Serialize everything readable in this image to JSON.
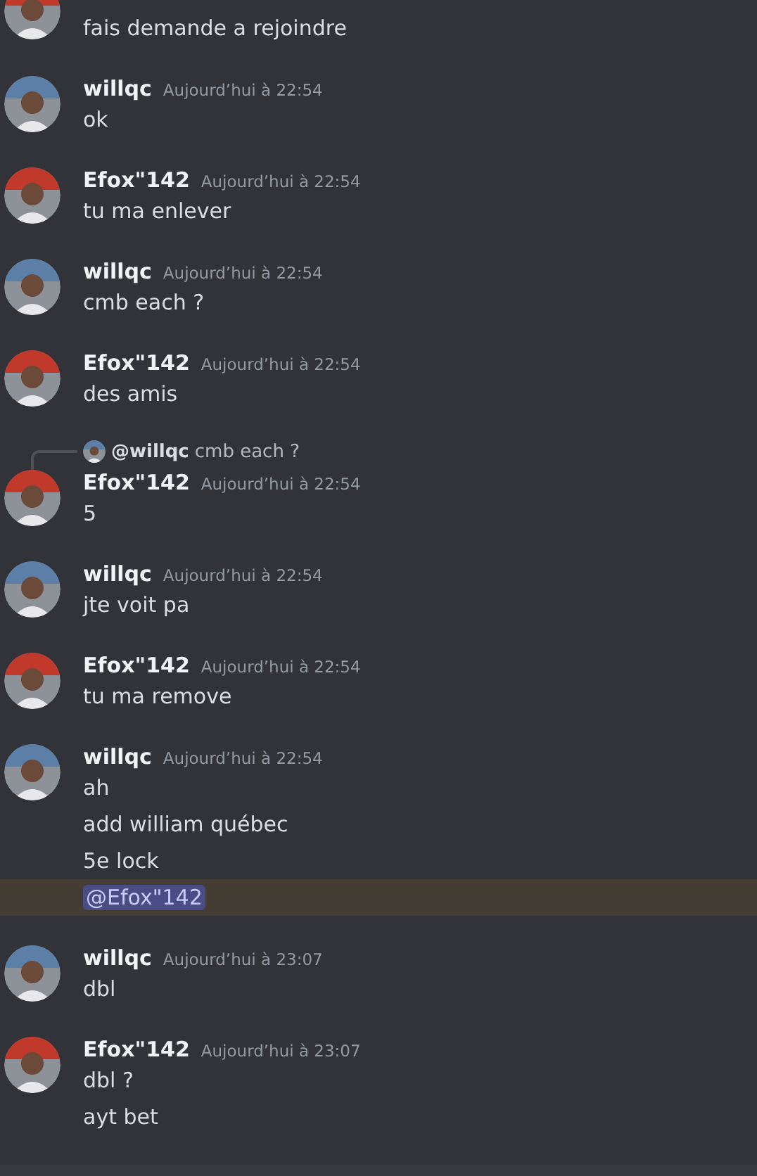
{
  "messages": [
    {
      "kind": "cut",
      "color": "#c0392b",
      "lines": [
        {
          "kind": "text",
          "text": "fais demande a rejoindre",
          "highlighted": false
        }
      ]
    },
    {
      "kind": "full",
      "author": "willqc",
      "time": "Aujourd’hui à 22:54",
      "color": "#5b7fa6",
      "lines": [
        {
          "kind": "text",
          "text": "ok",
          "highlighted": false
        }
      ]
    },
    {
      "kind": "full",
      "author": "Efox\"142",
      "time": "Aujourd’hui à 22:54",
      "color": "#c0392b",
      "lines": [
        {
          "kind": "text",
          "text": "tu ma enlever",
          "highlighted": false
        }
      ]
    },
    {
      "kind": "full",
      "author": "willqc",
      "time": "Aujourd’hui à 22:54",
      "color": "#5b7fa6",
      "lines": [
        {
          "kind": "text",
          "text": "cmb each ?",
          "highlighted": false
        }
      ]
    },
    {
      "kind": "full",
      "author": "Efox\"142",
      "time": "Aujourd’hui à 22:54",
      "color": "#c0392b",
      "lines": [
        {
          "kind": "text",
          "text": "des amis",
          "highlighted": false
        }
      ]
    },
    {
      "kind": "full",
      "author": "Efox\"142",
      "time": "Aujourd’hui à 22:54",
      "color": "#c0392b",
      "reply": {
        "mention": "@willqc",
        "text": "cmb each ?",
        "color": "#5b7fa6"
      },
      "lines": [
        {
          "kind": "text",
          "text": "5",
          "highlighted": false
        }
      ]
    },
    {
      "kind": "full",
      "author": "willqc",
      "time": "Aujourd’hui à 22:54",
      "color": "#5b7fa6",
      "lines": [
        {
          "kind": "text",
          "text": "jte voit pa",
          "highlighted": false
        }
      ]
    },
    {
      "kind": "full",
      "author": "Efox\"142",
      "time": "Aujourd’hui à 22:54",
      "color": "#c0392b",
      "lines": [
        {
          "kind": "text",
          "text": "tu ma remove",
          "highlighted": false
        }
      ]
    },
    {
      "kind": "full",
      "author": "willqc",
      "time": "Aujourd’hui à 22:54",
      "color": "#5b7fa6",
      "lines": [
        {
          "kind": "text",
          "text": "ah",
          "highlighted": false
        },
        {
          "kind": "text",
          "text": "add william québec",
          "highlighted": false
        },
        {
          "kind": "text",
          "text": "5e lock",
          "highlighted": false
        },
        {
          "kind": "mention",
          "text": "@Efox\"142",
          "highlighted": true
        }
      ]
    },
    {
      "kind": "full",
      "author": "willqc",
      "time": "Aujourd’hui à 23:07",
      "color": "#5b7fa6",
      "lines": [
        {
          "kind": "text",
          "text": "dbl",
          "highlighted": false
        }
      ]
    },
    {
      "kind": "full",
      "author": "Efox\"142",
      "time": "Aujourd’hui à 23:07",
      "color": "#c0392b",
      "lines": [
        {
          "kind": "text",
          "text": "dbl ?",
          "highlighted": false
        },
        {
          "kind": "text",
          "text": "ayt bet",
          "highlighted": false
        }
      ]
    }
  ]
}
